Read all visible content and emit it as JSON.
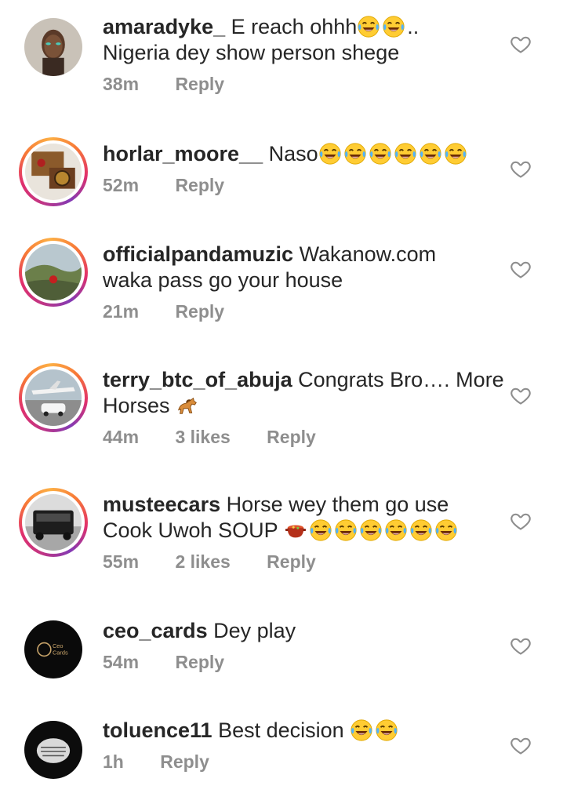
{
  "comments": [
    {
      "username": "amaradyke_",
      "lines": [
        "E reach ohhh",
        "Nigeria dey show person shege"
      ],
      "emoji_after_line1": [
        "laughing-tears",
        "laughing-tears"
      ],
      "suffix_after_emoji": "..",
      "time": "38m",
      "likes": "",
      "reply": "Reply",
      "avatar_icon": "woman-portrait-avatar",
      "story_ring": false
    },
    {
      "username": "horlar_moore__",
      "lines": [
        "Naso"
      ],
      "emoji_after_line1": [
        "laughing-tears",
        "laughing-tears",
        "laughing-tears",
        "laughing-tears",
        "laughing-tears",
        "laughing-tears"
      ],
      "time": "52m",
      "likes": "",
      "reply": "Reply",
      "avatar_icon": "watch-box-avatar",
      "story_ring": true
    },
    {
      "username": "officialpandamuzic",
      "lines": [
        "Wakanow.com",
        "waka pass go your house"
      ],
      "time": "21m",
      "likes": "",
      "reply": "Reply",
      "avatar_icon": "hill-landscape-avatar",
      "story_ring": true
    },
    {
      "username": "terry_btc_of_abuja",
      "lines": [
        "Congrats Bro…. More",
        "Horses"
      ],
      "emoji_after_line2": [
        "horse"
      ],
      "time": "44m",
      "likes": "3 likes",
      "reply": "Reply",
      "avatar_icon": "jet-car-avatar",
      "story_ring": true
    },
    {
      "username": "musteecars",
      "lines": [
        "Horse wey them go use",
        "Cook Uwoh SOUP"
      ],
      "emoji_after_line2": [
        "pot-of-food",
        "laughing-tears",
        "laughing-tears",
        "laughing-tears",
        "laughing-tears",
        "laughing-tears",
        "laughing-tears"
      ],
      "time": "55m",
      "likes": "2 likes",
      "reply": "Reply",
      "avatar_icon": "black-suv-avatar",
      "story_ring": true
    },
    {
      "username": "ceo_cards",
      "lines": [
        "Dey play"
      ],
      "time": "54m",
      "likes": "",
      "reply": "Reply",
      "avatar_icon": "ceo-cards-logo-avatar",
      "avatar_logo_text": [
        "Ceo",
        "Cards"
      ],
      "story_ring": false
    },
    {
      "username": "toluence11",
      "lines": [
        "Best decision"
      ],
      "emoji_after_line1": [
        "laughing-tears",
        "laughing-tears"
      ],
      "time": "1h",
      "likes": "",
      "reply": "Reply",
      "avatar_icon": "fist-bw-avatar",
      "story_ring": false
    }
  ],
  "colors": {
    "text": "#262626",
    "meta": "#8e8e8e",
    "heart_outline": "#8e8e8e"
  },
  "heart_icon": "heart-outline-icon"
}
